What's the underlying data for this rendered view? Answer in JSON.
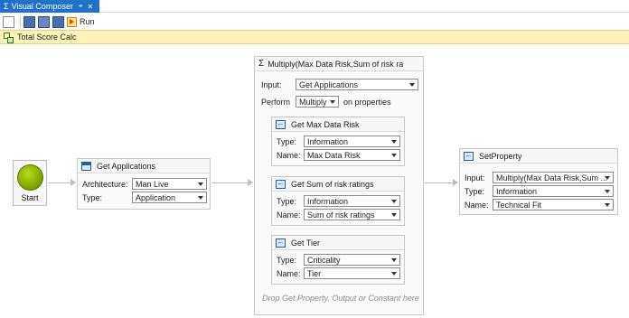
{
  "window": {
    "tab_title": "Visual Composer",
    "tab_pin_glyph": "⌖",
    "tab_close_glyph": "✕",
    "tab_icon": "sigma-icon"
  },
  "toolbar": {
    "run_label": "Run",
    "icons": [
      "new-document-icon",
      "save-icon",
      "save-as-icon",
      "save-all-icon",
      "run-icon"
    ]
  },
  "infobar": {
    "title": "Total Score Calc",
    "icon": "hierarchy-icon"
  },
  "start": {
    "label": "Start"
  },
  "get_applications": {
    "title": "Get Applications",
    "architecture_label": "Architecture:",
    "architecture_value": "Man Live",
    "type_label": "Type:",
    "type_value": "Application"
  },
  "multiply": {
    "title": "Multiply(Max Data Risk,Sum of risk ra",
    "input_label": "Input:",
    "input_value": "Get Applications",
    "perform_label": "Perform",
    "perform_value": "Multiply",
    "perform_suffix": "on properties",
    "drop_hint": "Drop Get Property, Output or Constant here",
    "properties": [
      {
        "title": "Get Max Data Risk",
        "type_label": "Type:",
        "type_value": "Information",
        "name_label": "Name:",
        "name_value": "Max Data Risk"
      },
      {
        "title": "Get Sum of risk ratings",
        "type_label": "Type:",
        "type_value": "Information",
        "name_label": "Name:",
        "name_value": "Sum of risk ratings"
      },
      {
        "title": "Get Tier",
        "type_label": "Type:",
        "type_value": "Criticality",
        "name_label": "Name:",
        "name_value": "Tier"
      }
    ]
  },
  "set_property": {
    "title": "SetProperty",
    "input_label": "Input:",
    "input_value": "Multiply(Max Data Risk,Sum ...",
    "type_label": "Type:",
    "type_value": "Information",
    "name_label": "Name:",
    "name_value": "Technical Fit"
  },
  "colors": {
    "tab_accent": "#1e72c8",
    "infobar_bg": "#fff1b8",
    "start_green": "#86ad00"
  }
}
